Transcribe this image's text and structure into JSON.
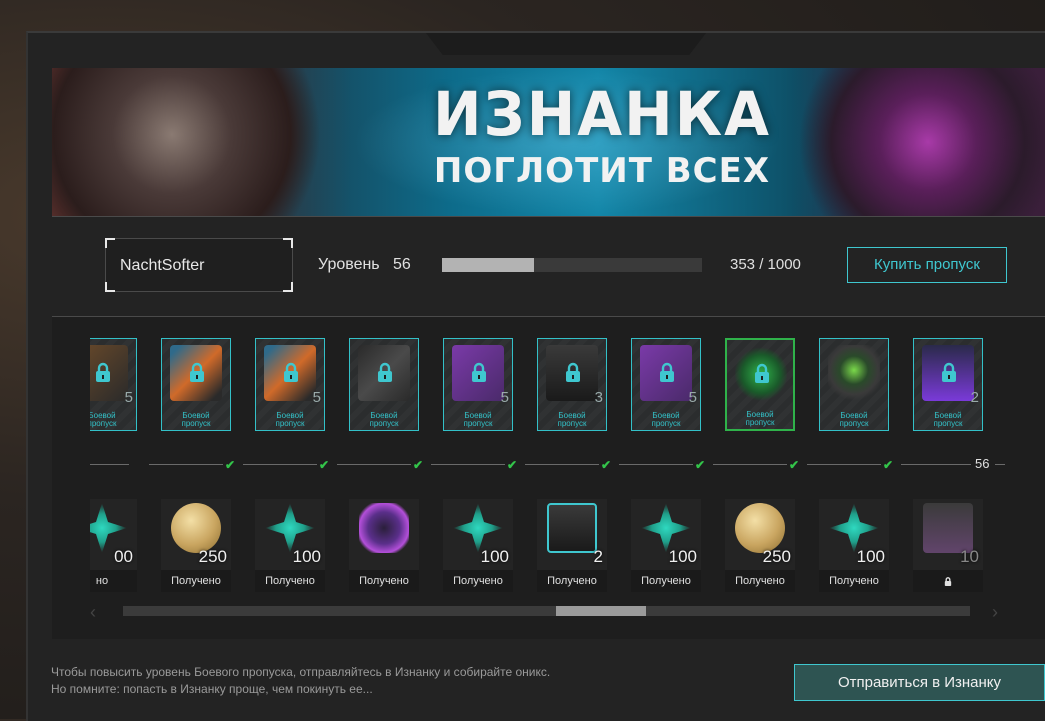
{
  "banner": {
    "title": "ИЗНАНКА",
    "subtitle": "ПОГЛОТИТ ВСЕХ"
  },
  "player": {
    "name": "NachtSofter",
    "level_label": "Уровень",
    "level": "56",
    "xp_text": "353 / 1000",
    "xp_fraction": 0.353
  },
  "buy_button": "Купить пропуск",
  "battle_pass_label": [
    "Боевой",
    "пропуск"
  ],
  "track_level_marker": "56",
  "battle_pass_items": [
    {
      "count": "5",
      "kind": "partial",
      "unlocked": false
    },
    {
      "count": "",
      "kind": "weapon-orange",
      "unlocked": false
    },
    {
      "count": "5",
      "kind": "weapon-orange",
      "unlocked": false
    },
    {
      "count": "",
      "kind": "weapon-dark",
      "unlocked": false
    },
    {
      "count": "5",
      "kind": "box-purple",
      "unlocked": false
    },
    {
      "count": "3",
      "kind": "crate",
      "unlocked": false
    },
    {
      "count": "5",
      "kind": "box-purple",
      "unlocked": false
    },
    {
      "count": "",
      "kind": "figure-green",
      "unlocked": false,
      "highlight": true
    },
    {
      "count": "",
      "kind": "mask",
      "unlocked": true
    },
    {
      "count": "2",
      "kind": "grenade-purple",
      "unlocked": false
    },
    {
      "count": "",
      "kind": "partial",
      "unlocked": false
    }
  ],
  "free_rewards": [
    {
      "count": "00",
      "kind": "crystal",
      "status": "но"
    },
    {
      "count": "250",
      "kind": "coin",
      "status": "Получено"
    },
    {
      "count": "100",
      "kind": "crystal",
      "status": "Получено"
    },
    {
      "count": "",
      "kind": "cube",
      "status": "Получено"
    },
    {
      "count": "100",
      "kind": "crystal",
      "status": "Получено"
    },
    {
      "count": "2",
      "kind": "box",
      "status": "Получено"
    },
    {
      "count": "100",
      "kind": "crystal",
      "status": "Получено"
    },
    {
      "count": "250",
      "kind": "coin",
      "status": "Получено"
    },
    {
      "count": "100",
      "kind": "crystal",
      "status": "Получено"
    },
    {
      "count": "10",
      "kind": "grenade-locked",
      "status": ""
    },
    {
      "count": "",
      "kind": "crystal",
      "status": ""
    }
  ],
  "footer": {
    "line1": "Чтобы повысить уровень Боевого пропуска, отправляйтесь в Изнанку и собирайте оникс.",
    "line2": "Но помните: попасть в Изнанку проще, чем покинуть ее..."
  },
  "go_button": "Отправиться в Изнанку",
  "colors": {
    "accent": "#3fc7cf",
    "claimed_check": "#33c44a",
    "panel": "#1e1e1e",
    "button_fill": "#2e5452"
  }
}
